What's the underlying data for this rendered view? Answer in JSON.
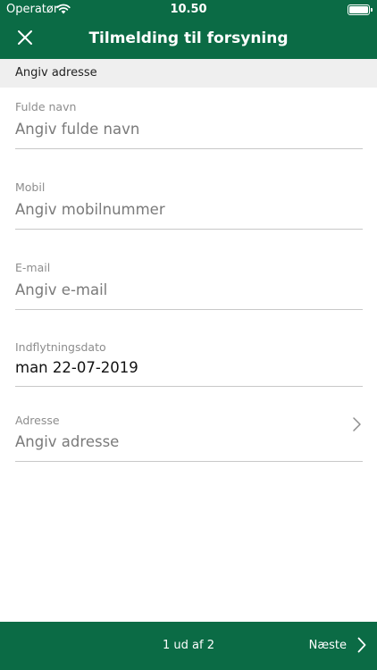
{
  "status_bar": {
    "carrier": "Operatør",
    "time": "10.50",
    "wifi_icon": "wifi-icon",
    "battery_icon": "battery-icon"
  },
  "nav": {
    "title": "Tilmelding til forsyning",
    "close_icon": "close-icon"
  },
  "section": {
    "header": "Angiv adresse"
  },
  "fields": {
    "full_name": {
      "label": "Fulde navn",
      "placeholder": "Angiv fulde navn",
      "value": ""
    },
    "mobile": {
      "label": "Mobil",
      "placeholder": "Angiv mobilnummer",
      "value": ""
    },
    "email": {
      "label": "E-mail",
      "placeholder": "Angiv e-mail",
      "value": ""
    },
    "move_in_date": {
      "label": "Indflytningsdato",
      "value": "man 22-07-2019"
    },
    "address": {
      "label": "Adresse",
      "placeholder": "Angiv adresse",
      "value": ""
    }
  },
  "footer": {
    "page_indicator": "1 ud af 2",
    "next_label": "Næste",
    "next_icon": "chevron-right-icon"
  },
  "colors": {
    "brand_green": "#0b6b45",
    "section_bg": "#efefef",
    "divider": "#c8c8c8"
  }
}
